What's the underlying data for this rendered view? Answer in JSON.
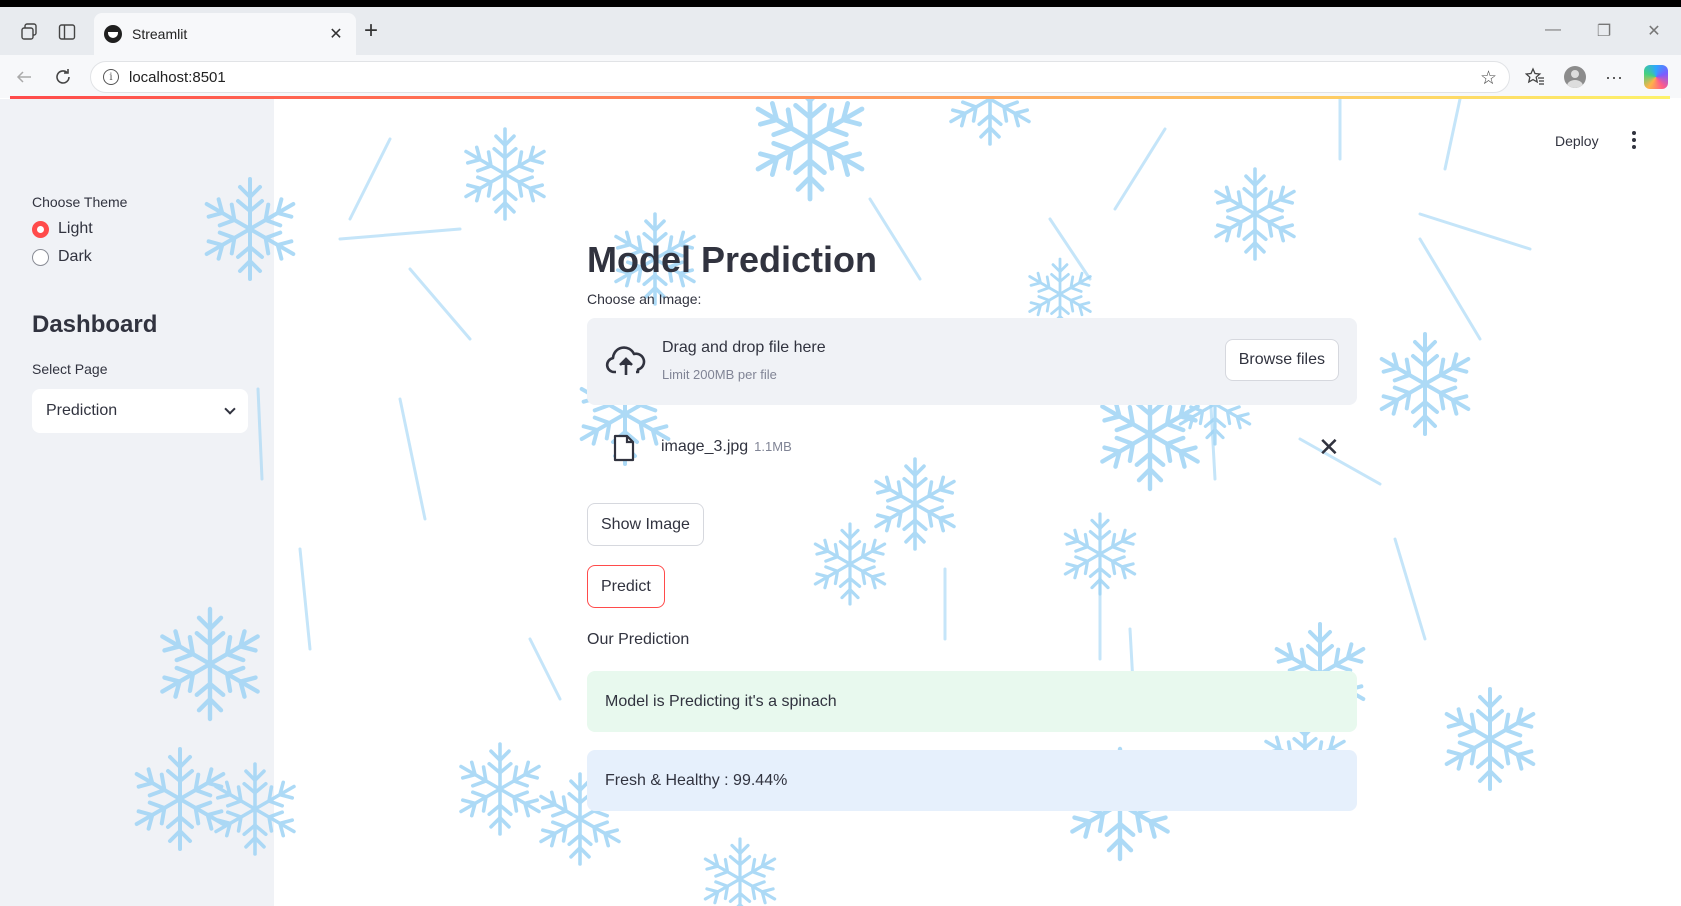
{
  "browser": {
    "tab_title": "Streamlit",
    "tab_close": "✕",
    "new_tab": "+",
    "url": "localhost:8501",
    "icons": [
      "workspaces-icon",
      "tab-actions-icon",
      "back-icon",
      "refresh-icon",
      "site-info-icon",
      "favorite-star-icon",
      "favorites-icon",
      "profile-icon",
      "more-icon",
      "copilot-icon"
    ],
    "window_controls": [
      "—",
      "❐",
      "✕"
    ]
  },
  "sidebar": {
    "theme_label": "Choose Theme",
    "theme_options": [
      "Light",
      "Dark"
    ],
    "theme_selected": "Light",
    "title": "Dashboard",
    "select_label": "Select Page",
    "select_value": "Prediction"
  },
  "header": {
    "deploy_label": "Deploy"
  },
  "main": {
    "title": "Model Prediction",
    "uploader_label": "Choose an Image:",
    "dropzone_text": "Drag and drop file here",
    "dropzone_limit": "Limit 200MB per file",
    "browse_label": "Browse files",
    "file_name": "image_3.jpg",
    "file_size": "1.1MB",
    "show_image_label": "Show Image",
    "predict_label": "Predict",
    "prediction_heading": "Our Prediction",
    "success_text": "Model is Predicting it's a spinach",
    "info_text": "Fresh & Healthy : 99.44%"
  },
  "colors": {
    "accent": "#ff4b4b",
    "sidebar_bg": "#f0f2f6",
    "success_bg": "#e8f9ee",
    "info_bg": "#e6f0fc",
    "snowflake": "#9fd4f5"
  }
}
